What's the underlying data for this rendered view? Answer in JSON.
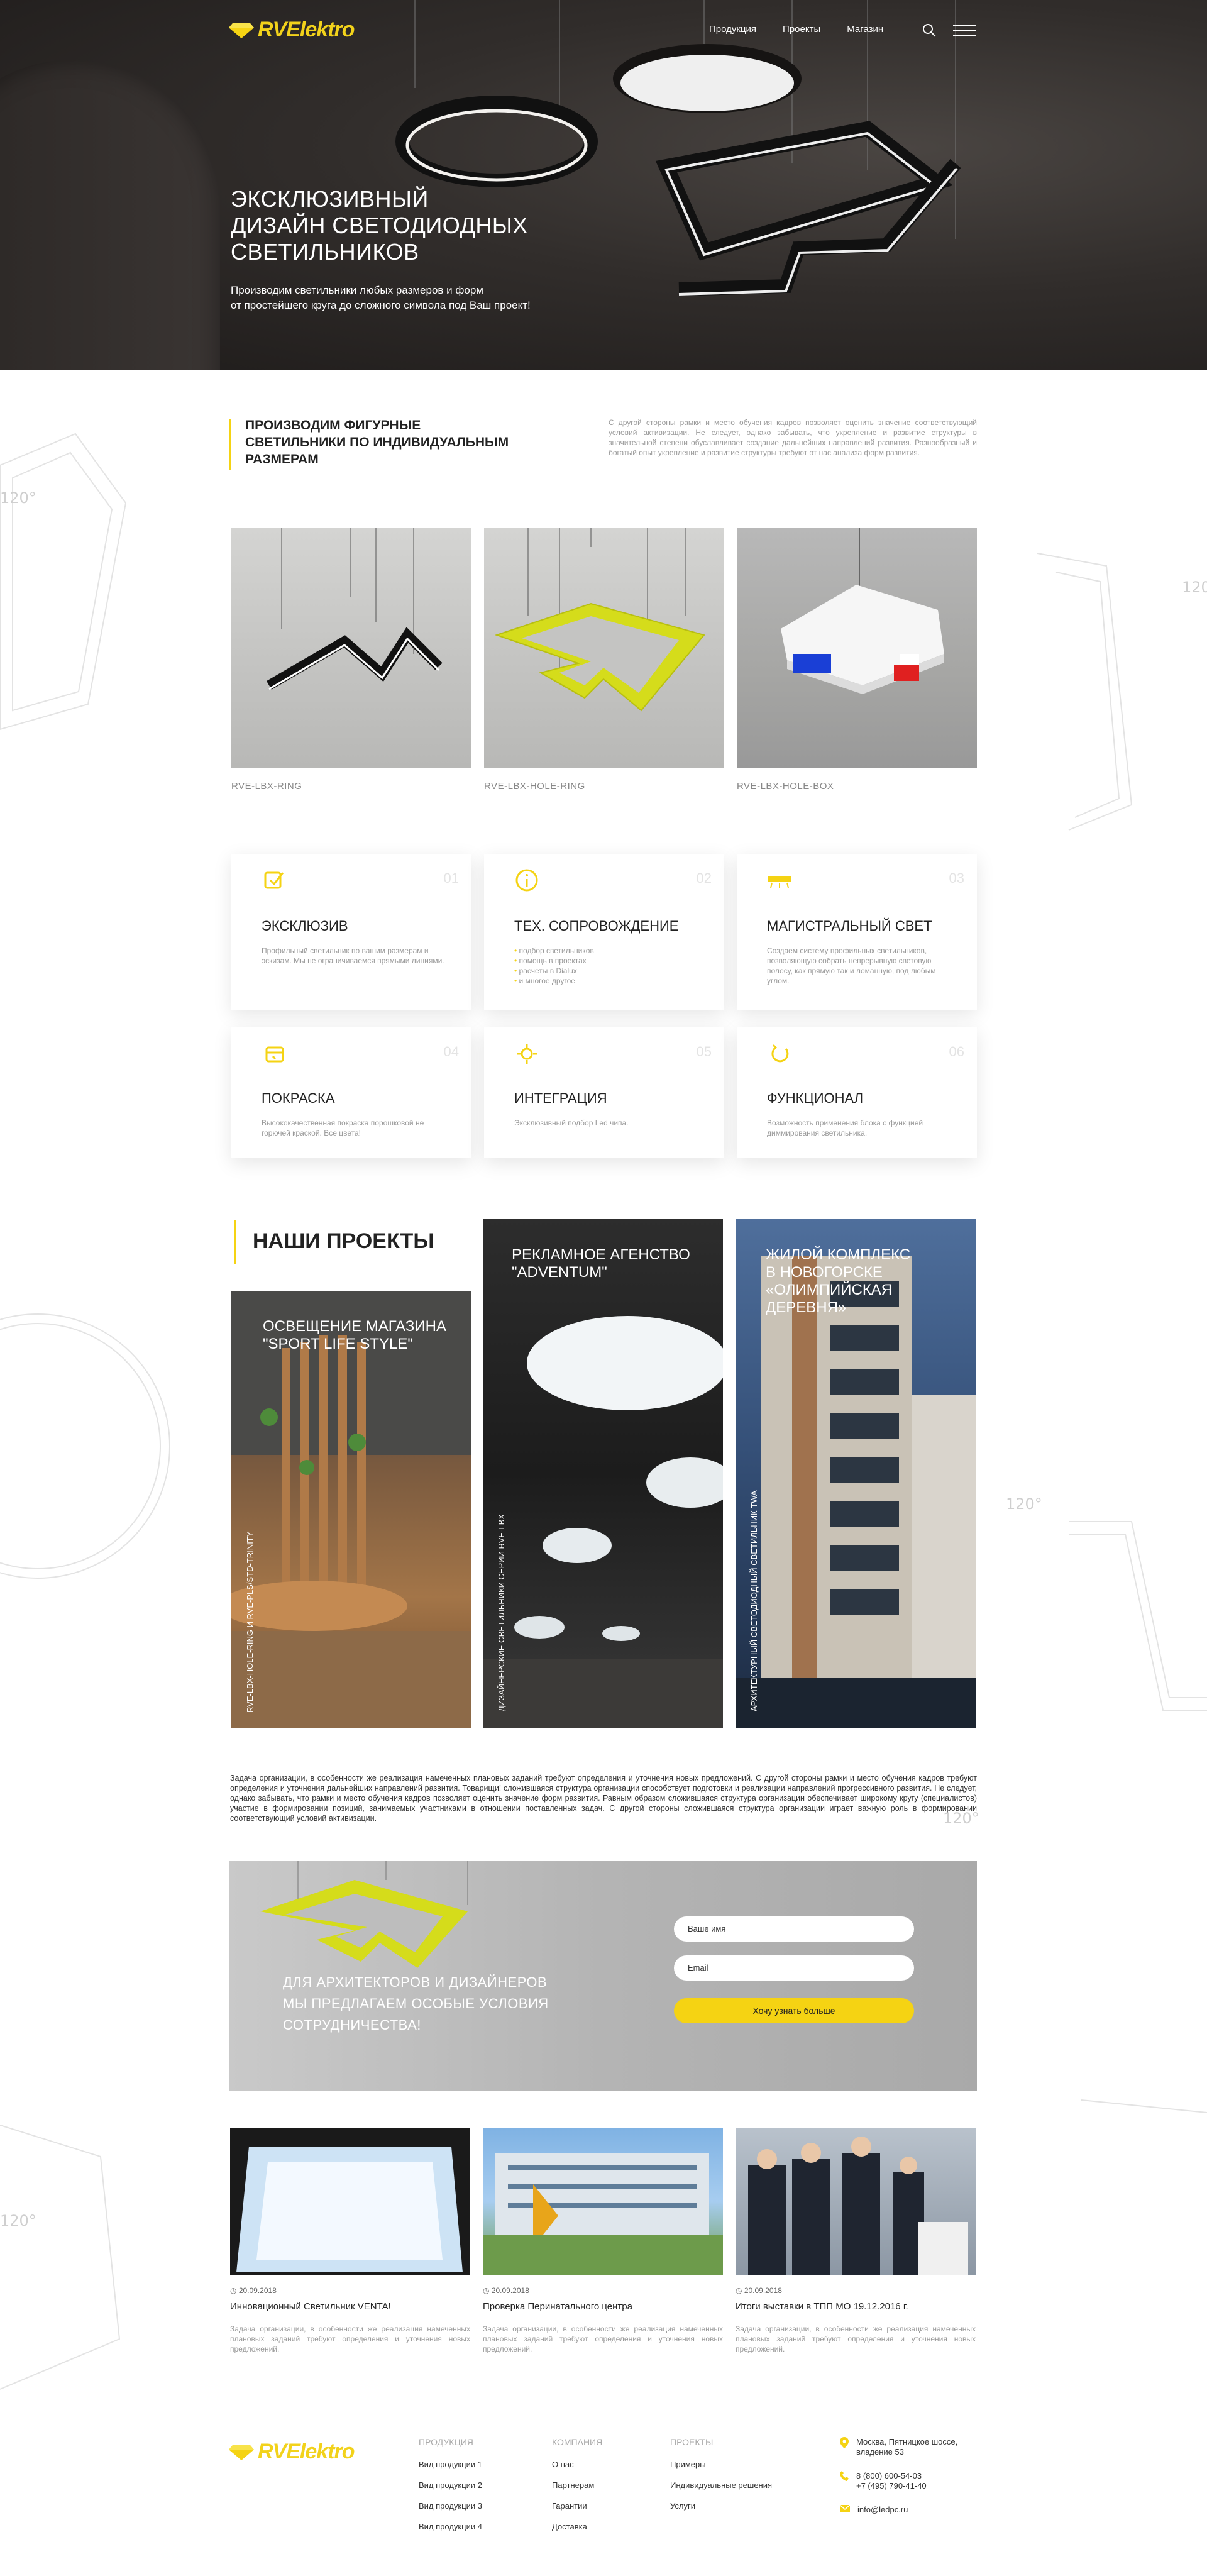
{
  "brand": {
    "name": "RVElektro",
    "accent": "#f5d313",
    "dark": "#2b2826"
  },
  "nav": {
    "items": [
      "Продукция",
      "Проекты",
      "Магазин"
    ],
    "icons": [
      "search-icon",
      "menu-icon"
    ]
  },
  "hero": {
    "title_lines": [
      "ЭКСКЛЮЗИВНЫЙ",
      "ДИЗАЙН СВЕТОДИОДНЫХ",
      "СВЕТИЛЬНИКОВ"
    ],
    "subtitle_lines": [
      "Производим светильники любых размеров и форм",
      "от простейшего круга до сложного символа под Ваш проект!"
    ]
  },
  "intro": {
    "title_lines": [
      "ПРОИЗВОДИМ ФИГУРНЫЕ",
      "СВЕТИЛЬНИКИ ПО ИНДИВИДУАЛЬНЫМ",
      "РАЗМЕРАМ"
    ],
    "text": "С другой стороны рамки и место обучения кадров позволяет оценить значение соответствующий условий активизации. Не следует, однако забывать, что укрепление и развитие структуры в значительной степени обуславливает создание дальнейших направлений развития. Разнообразный и богатый опыт укрепление и развитие структуры требуют от нас анализа форм развития."
  },
  "products": [
    {
      "name": "RVE-LBX-RING"
    },
    {
      "name": "RVE-LBX-HOLE-RING"
    },
    {
      "name": "RVE-LBX-HOLE-BOX"
    }
  ],
  "features": [
    {
      "num": "01",
      "icon": "exclusive-icon",
      "title": "ЭКСКЛЮЗИВ",
      "text": "Профильный светильник по вашим размерам и эскизам. Мы не ограничиваемся прямыми линиями."
    },
    {
      "num": "02",
      "icon": "info-icon",
      "title": "ТЕХ. СОПРОВОЖДЕНИЕ",
      "list": [
        "подбор светильников",
        "помощь в проектах",
        "расчеты в Dialux",
        "и многое другое"
      ]
    },
    {
      "num": "03",
      "icon": "main-light-icon",
      "title": "МАГИСТРАЛЬНЫЙ СВЕТ",
      "text": "Создаем систему профильных светильников, позволяющую собрать непрерывную световую полосу, как прямую так и ломанную, под любым углом."
    },
    {
      "num": "04",
      "icon": "paint-icon",
      "title": "ПОКРАСКА",
      "text": "Высококачественная покраска порошковой не горючей краской. Все цвета!"
    },
    {
      "num": "05",
      "icon": "integration-icon",
      "title": "ИНТЕГРАЦИЯ",
      "text": "Эксклюзивный подбор Led чипа."
    },
    {
      "num": "06",
      "icon": "function-icon",
      "title": "ФУНКЦИОНАЛ",
      "text": "Возможность применения блока с функцией диммирования светильника."
    }
  ],
  "projects": {
    "heading": "НАШИ ПРОЕКТЫ",
    "items": [
      {
        "title_lines": [
          "ОСВЕЩЕНИЕ МАГАЗИНА",
          "\"SPORT LIFE STYLE\""
        ],
        "vertical": "RVE-LBX-HOLE-RING И RVE-PLS/STD-TRINITY"
      },
      {
        "title_lines": [
          "РЕКЛАМНОЕ АГЕНСТВО",
          "\"ADVENTUM\""
        ],
        "vertical": "ДИЗАЙНЕРСКИЕ СВЕТИЛЬНИКИ СЕРИИ RVE-LBX"
      },
      {
        "title_lines": [
          "ЖИЛОЙ КОМПЛЕКС",
          "В НОВОГОРСКЕ",
          "«ОЛИМПИЙСКАЯ ДЕРЕВНЯ»"
        ],
        "vertical": "АРХИТЕКТУРНЫЙ СВЕТОДИОДНЫЙ СВЕТИЛЬНИК TWA"
      }
    ]
  },
  "about_text": "Задача организации, в особенности же реализация намеченных плановых заданий требуют определения и уточнения новых предложений. С другой стороны рамки и место обучения кадров требуют определения и уточнения дальнейших направлений развития. Товарищи! сложившаяся структура организации способствует подготовки и реализации направлений прогрессивного развития. Не следует, однако забывать, что рамки и место обучения кадров позволяет оценить значение форм развития. Равным образом сложившаяся структура организации обеспечивает широкому кругу (специалистов) участие в формировании позиций, занимаемых участниками в отношении поставленных задач. С другой стороны сложившаяся структура организации играет важную роль в формировании соответствующий условий активизации.",
  "offer": {
    "text_lines": [
      "ДЛЯ АРХИТЕКТОРОВ И ДИЗАЙНЕРОВ",
      "МЫ ПРЕДЛАГАЕМ ОСОБЫЕ УСЛОВИЯ",
      "СОТРУДНИЧЕСТВА!"
    ],
    "name_placeholder": "Ваше имя",
    "email_placeholder": "Email",
    "button": "Хочу узнать больше"
  },
  "news": [
    {
      "date": "20.09.2018",
      "title": "Инновационный Светильник VENTA!",
      "text": "Задача организации, в особенности же реализация намеченных плановых заданий требуют определения и уточнения новых предложений."
    },
    {
      "date": "20.09.2018",
      "title": "Проверка Перинатального центра",
      "text": "Задача организации, в особенности же реализация намеченных плановых заданий требуют определения и уточнения новых предложений."
    },
    {
      "date": "20.09.2018",
      "title": "Итоги выставки в ТПП МО 19.12.2016 г.",
      "text": "Задача организации, в особенности же реализация намеченных плановых заданий требуют определения и уточнения новых предложений."
    }
  ],
  "footer": {
    "columns": [
      {
        "heading": "ПРОДУКЦИЯ",
        "links": [
          "Вид продукции 1",
          "Вид продукции 2",
          "Вид продукции 3",
          "Вид продукции 4"
        ]
      },
      {
        "heading": "КОМПАНИЯ",
        "links": [
          "О нас",
          "Партнерам",
          "Гарантии",
          "Доставка"
        ]
      },
      {
        "heading": "ПРОЕКТЫ",
        "links": [
          "Примеры",
          "Индивидуальные решения",
          "Услуги"
        ]
      }
    ],
    "address_lines": [
      "Москва, Пятницкое шоссе,",
      "владение 53"
    ],
    "phones": [
      "8 (800) 600-54-03",
      "+7 (495) 790-41-40"
    ],
    "email": "info@ledpc.ru"
  }
}
